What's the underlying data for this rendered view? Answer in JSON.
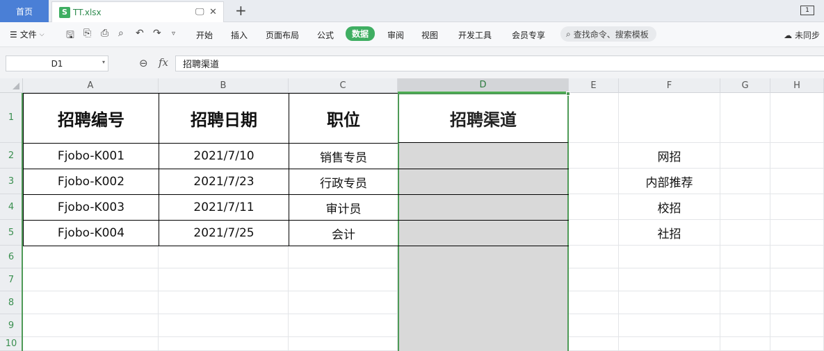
{
  "tabs": {
    "home_label": "首页",
    "file_badge": "S",
    "file_name": "TT.xlsx",
    "new_tab": "+",
    "window_badge": "1"
  },
  "menu": {
    "file_label": "文件",
    "items": [
      "开始",
      "插入",
      "页面布局",
      "公式",
      "数据",
      "审阅",
      "视图",
      "开发工具",
      "会员专享"
    ],
    "active": "数据",
    "search_placeholder": "查找命令、搜索模板",
    "sync_label": "未同步"
  },
  "formula_bar": {
    "name_box": "D1",
    "fx": "fx",
    "value": "招聘渠道"
  },
  "sheet": {
    "columns": [
      "A",
      "B",
      "C",
      "D",
      "E",
      "F",
      "G",
      "H"
    ],
    "rows": [
      "1",
      "2",
      "3",
      "4",
      "5",
      "6",
      "7",
      "8",
      "9",
      "10"
    ],
    "headers": [
      "招聘编号",
      "招聘日期",
      "职位",
      "招聘渠道"
    ],
    "data": [
      [
        "Fjobo-K001",
        "2021/7/10",
        "销售专员"
      ],
      [
        "Fjobo-K002",
        "2021/7/23",
        "行政专员"
      ],
      [
        "Fjobo-K003",
        "2021/7/11",
        "审计员"
      ],
      [
        "Fjobo-K004",
        "2021/7/25",
        "会计"
      ]
    ],
    "f_list": [
      "网招",
      "内部推荐",
      "校招",
      "社招"
    ]
  },
  "colors": {
    "accent_green": "#3fae62",
    "home_tab_blue": "#4a7fd6",
    "selection_green": "#4e9a57",
    "selection_fill": "#d9d9d9"
  }
}
